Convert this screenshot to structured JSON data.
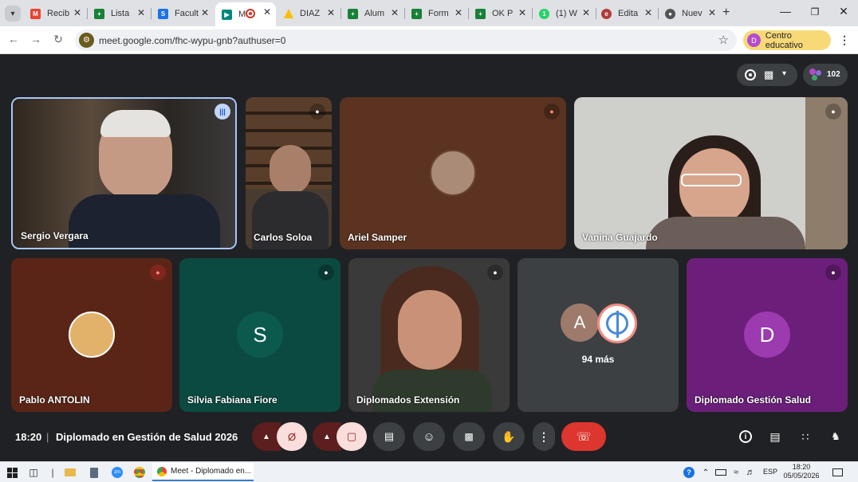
{
  "browser": {
    "tabs": [
      {
        "label": "Recib",
        "icon": "gmail-icon",
        "color": "#ea4335"
      },
      {
        "label": "Lista",
        "icon": "sheets-icon",
        "color": "#188038"
      },
      {
        "label": "Facult",
        "icon": "sites-icon",
        "color": "#1a73e8"
      },
      {
        "label": "M",
        "icon": "meet-icon",
        "color": "#00897b"
      },
      {
        "label": "DIAZ",
        "icon": "drive-icon",
        "color": "#fbbc04"
      },
      {
        "label": "Alum",
        "icon": "sheets-icon",
        "color": "#188038"
      },
      {
        "label": "Form",
        "icon": "sheets-icon",
        "color": "#188038"
      },
      {
        "label": "OK P",
        "icon": "sheets-icon",
        "color": "#188038"
      },
      {
        "label": "(1) W",
        "icon": "whatsapp-icon",
        "color": "#25d366"
      },
      {
        "label": "Edita",
        "icon": "editor-icon",
        "color": "#b23b3b"
      },
      {
        "label": "Nuev",
        "icon": "chrome-icon",
        "color": "#555555"
      }
    ],
    "url": "meet.google.com/fhc-wypu-gnb?authuser=0",
    "profile_label": "Centro educativo",
    "profile_initial": "D"
  },
  "meet": {
    "participant_count": "102",
    "tiles": [
      {
        "name": "Sergio Vergara",
        "type": "video",
        "bg": "#3a3128",
        "speaking": true
      },
      {
        "name": "Carlos Soloa",
        "type": "video",
        "bg": "#4a3b30",
        "muted": true
      },
      {
        "name": "Ariel Samper",
        "type": "photo",
        "bg": "#5b3320",
        "muted": true
      },
      {
        "name": "Vanina Guajardo",
        "type": "video",
        "bg": "#cfcfcc",
        "muted": true
      },
      {
        "name": "Pablo ANTOLIN",
        "type": "photo",
        "bg": "#5a2517",
        "muted": true
      },
      {
        "name": "Silvia Fabiana Fiore",
        "type": "initial",
        "initial": "S",
        "bg": "#0b4a40",
        "avatar_color": "#0c5a4e",
        "muted": true
      },
      {
        "name": "Diplomados Extensión",
        "type": "video",
        "bg": "#3b3a3a",
        "muted": true
      },
      {
        "name": "94 más",
        "type": "more",
        "bg": "#3c4043",
        "avatar_initial": "A"
      },
      {
        "name": "Diplomado Gestión Salud",
        "type": "initial",
        "initial": "D",
        "bg": "#6b1f7a",
        "avatar_color": "#9c3ab0",
        "muted": true
      }
    ],
    "time": "18:20",
    "separator": "|",
    "meeting_title": "Diplomado en Gestión de Salud 2026"
  },
  "taskbar": {
    "app_label": "Meet - Diplomado en...",
    "language": "ESP",
    "clock_time": "18:20",
    "clock_date": "05/05/2026"
  }
}
